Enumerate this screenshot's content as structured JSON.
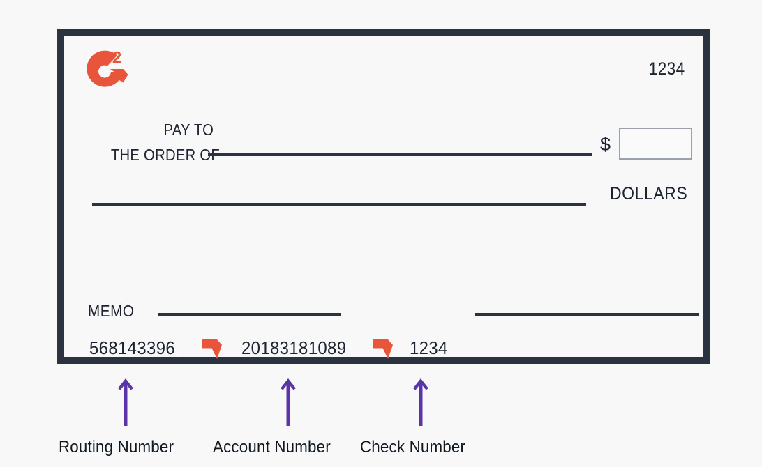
{
  "page": {
    "background_color": "#f8f8f8",
    "title": "Check anatomy diagram"
  },
  "check": {
    "border_color": "#2b3240",
    "face_color": "#f8f8f8",
    "brand": {
      "logo_name": "g2-logo",
      "logo_color": "#e8553a",
      "superscript": "2"
    },
    "check_number_top_right": "1234",
    "pay_to": {
      "line1": "PAY TO",
      "line2": "THE ORDER OF"
    },
    "amount": {
      "currency_symbol": "$",
      "value": "",
      "box_border_color": "#9aa1ab"
    },
    "dollars_label": "DOLLARS",
    "memo_label": "MEMO",
    "memo_value": "",
    "signature_value": "",
    "micr": {
      "routing_number": "568143396",
      "transit_symbol_1": "micr-transit-symbol",
      "account_number": "20183181089",
      "transit_symbol_2": "micr-transit-symbol",
      "check_number": "1234",
      "symbol_color": "#e8553a"
    }
  },
  "callouts": {
    "arrow_color": "#5b35a8",
    "items": [
      {
        "label": "Routing Number",
        "target": "routing_number"
      },
      {
        "label": "Account Number",
        "target": "account_number"
      },
      {
        "label": "Check Number",
        "target": "check_number"
      }
    ]
  }
}
